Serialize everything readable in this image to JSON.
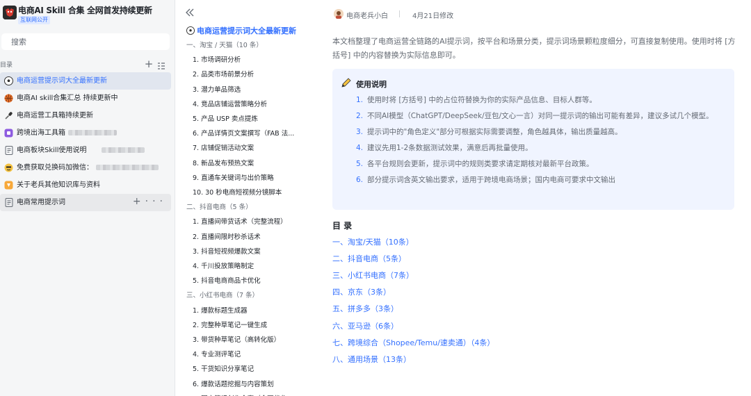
{
  "workspace": {
    "title": "电商AI Skill 合集 全网首发持续更新",
    "badge": "互联网公开"
  },
  "search": {
    "placeholder": "搜索"
  },
  "directory": {
    "label": "目录"
  },
  "sidebar": {
    "items": [
      {
        "label": "电商运营提示词大全最新更新",
        "icon": "soccer-ball-icon"
      },
      {
        "label": "电商AI skill合集汇总 持续更新中",
        "icon": "basketball-icon"
      },
      {
        "label": "电商运营工具箱持续更新",
        "icon": "microphone-icon"
      },
      {
        "label": "跨境出海工具箱",
        "icon": "purple-app-icon"
      },
      {
        "label": "电商板块Skill使用说明",
        "icon": "document-icon"
      },
      {
        "label": "免费获取兑换码加微信：",
        "icon": "emoji-icon"
      },
      {
        "label": "关于老兵其他知识库与资料",
        "icon": "orange-app-icon"
      },
      {
        "label": "电商常用提示词",
        "icon": "document-icon"
      }
    ]
  },
  "outline": {
    "title": "电商运营提示词大全最新更新",
    "items": [
      {
        "type": "sec",
        "label": "一、淘宝 / 天猫（10 条）"
      },
      {
        "type": "sub",
        "label": "1. 市场调研分析"
      },
      {
        "type": "sub",
        "label": "2. 品类市场前景分析"
      },
      {
        "type": "sub",
        "label": "3. 潜力单品筛选"
      },
      {
        "type": "sub",
        "label": "4. 竞品店铺运营策略分析"
      },
      {
        "type": "sub",
        "label": "5. 产品 USP 卖点提炼"
      },
      {
        "type": "sub",
        "label": "6. 产品详情页文案撰写（FAB 法..."
      },
      {
        "type": "sub",
        "label": "7. 店铺促销活动文案"
      },
      {
        "type": "sub",
        "label": "8. 新品发布预热文案"
      },
      {
        "type": "sub",
        "label": "9. 直通车关键词与出价策略"
      },
      {
        "type": "sub",
        "label": "10. 30 秒电商短视频分镜脚本"
      },
      {
        "type": "sec",
        "label": "二、抖音电商（5 条）"
      },
      {
        "type": "sub",
        "label": "1. 直播间带货话术（完整流程）"
      },
      {
        "type": "sub",
        "label": "2. 直播间限时秒杀话术"
      },
      {
        "type": "sub",
        "label": "3. 抖音短视频爆款文案"
      },
      {
        "type": "sub",
        "label": "4. 千川投放策略制定"
      },
      {
        "type": "sub",
        "label": "5. 抖音电商商品卡优化"
      },
      {
        "type": "sec",
        "label": "三、小红书电商（7 条）"
      },
      {
        "type": "sub",
        "label": "1. 爆款标题生成器"
      },
      {
        "type": "sub",
        "label": "2. 完整种草笔记一键生成"
      },
      {
        "type": "sub",
        "label": "3. 带货种草笔记（高转化版）"
      },
      {
        "type": "sub",
        "label": "4. 专业测评笔记"
      },
      {
        "type": "sub",
        "label": "5. 干货知识分享笔记"
      },
      {
        "type": "sub",
        "label": "6. 爆款话题挖掘与内容策划"
      },
      {
        "type": "sub",
        "label": "7. 图文笔记创作全套（全面优化"
      }
    ]
  },
  "doc": {
    "author": "电商老兵小白",
    "modified": "4月21日修改",
    "intro": "本文档整理了电商运营全链路的AI提示词，按平台和场景分类，提示词场景颗粒度细分，可直接复制使用。使用时将 [方括号] 中的内容替换为实际信息即可。",
    "callout": {
      "title": "使用说明",
      "items": [
        {
          "num": "1.",
          "text": "使用时将 [方括号] 中的占位符替换为你的实际产品信息、目标人群等。"
        },
        {
          "num": "2.",
          "text": "不同AI模型（ChatGPT/DeepSeek/豆包/文心一言）对同一提示词的输出可能有差异，建议多试几个模型。"
        },
        {
          "num": "3.",
          "text": "提示词中的\"角色定义\"部分可根据实际需要调整，角色越具体，输出质量越高。"
        },
        {
          "num": "4.",
          "text": "建议先用1-2条数据测试效果，满意后再批量使用。"
        },
        {
          "num": "5.",
          "text": "各平台规则会更新，提示词中的规则类要求请定期核对最新平台政策。"
        },
        {
          "num": "6.",
          "text": "部分提示词含英文输出要求，适用于跨境电商场景；国内电商可要求中文输出"
        }
      ]
    },
    "toc_title": "目 录",
    "toc": [
      "一、淘宝/天猫（10条）",
      "二、抖音电商（5条）",
      "三、小红书电商（7条）",
      "四、京东（3条）",
      "五、拼多多（3条）",
      "六、亚马逊（6条）",
      "七、跨境综合（Shopee/Temu/速卖通）（4条）",
      "八、通用场景（13条）"
    ]
  },
  "colors": {
    "accent": "#3370ff",
    "active_bg": "#e1e6ef",
    "callout_bg": "#f0f4ff"
  }
}
